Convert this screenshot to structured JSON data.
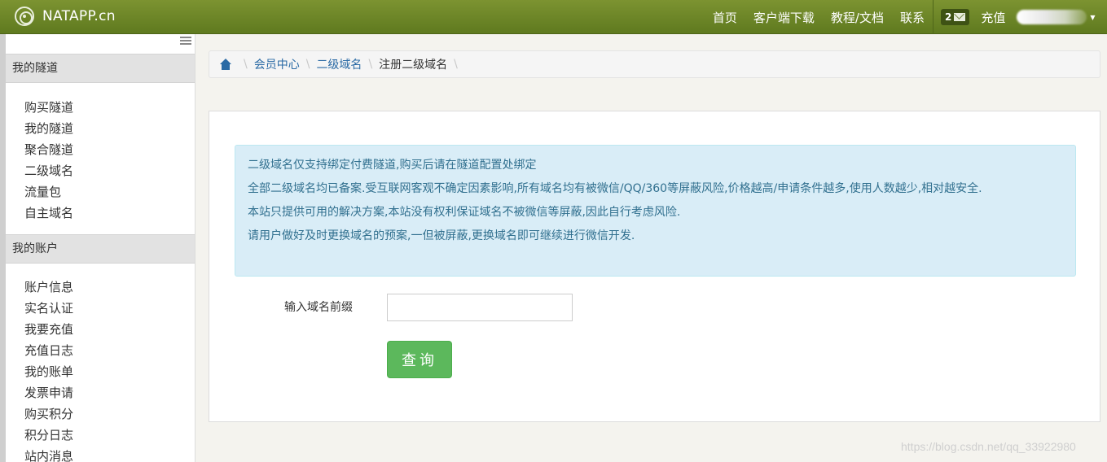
{
  "brand": {
    "name": "NATAPP.cn"
  },
  "nav": {
    "links": [
      "首页",
      "客户端下载",
      "教程/文档",
      "联系"
    ],
    "message_count": "2",
    "recharge": "充值"
  },
  "sidebar": {
    "sections": [
      {
        "title": "我的隧道",
        "items": [
          "购买隧道",
          "我的隧道",
          "聚合隧道",
          "二级域名",
          "流量包",
          "自主域名"
        ]
      },
      {
        "title": "我的账户",
        "items": [
          "账户信息",
          "实名认证",
          "我要充值",
          "充值日志",
          "我的账单",
          "发票申请",
          "购买积分",
          "积分日志",
          "站内消息"
        ]
      }
    ]
  },
  "breadcrumb": {
    "items": [
      "会员中心",
      "二级域名"
    ],
    "current": "注册二级域名"
  },
  "notice": {
    "lines": [
      "二级域名仅支持绑定付费隧道,购买后请在隧道配置处绑定",
      "全部二级域名均已备案.受互联网客观不确定因素影响,所有域名均有被微信/QQ/360等屏蔽风险,价格越高/申请条件越多,使用人数越少,相对越安全.",
      "本站只提供可用的解决方案,本站没有权利保证域名不被微信等屏蔽,因此自行考虑风险.",
      "请用户做好及时更换域名的预案,一但被屏蔽,更换域名即可继续进行微信开发."
    ]
  },
  "form": {
    "prefix_label": "输入域名前缀",
    "prefix_value": "",
    "query_button": "查询"
  },
  "watermark": "https://blog.csdn.net/qq_33922980"
}
